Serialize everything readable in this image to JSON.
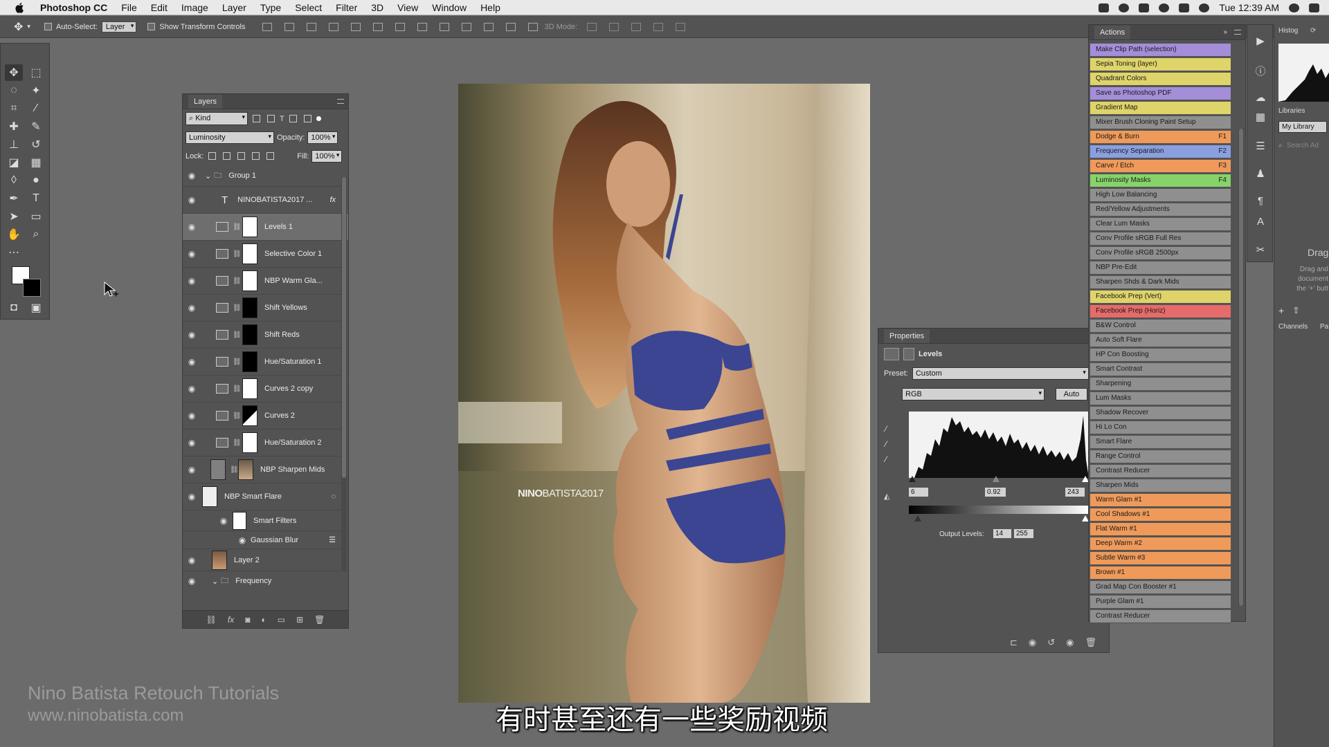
{
  "menubar": {
    "app_name": "Photoshop CC",
    "items": [
      "File",
      "Edit",
      "Image",
      "Layer",
      "Type",
      "Select",
      "Filter",
      "3D",
      "View",
      "Window",
      "Help"
    ],
    "clock": "Tue 12:39 AM"
  },
  "options_bar": {
    "auto_select_label": "Auto-Select:",
    "auto_select_value": "Layer",
    "show_transform_label": "Show Transform Controls",
    "mode_3d_label": "3D Mode:"
  },
  "layers_panel": {
    "tab": "Layers",
    "filter_kind": "Kind",
    "blend_mode": "Luminosity",
    "opacity_label": "Opacity:",
    "opacity_value": "100%",
    "lock_label": "Lock:",
    "fill_label": "Fill:",
    "fill_value": "100%",
    "group_name": "Group 1",
    "layers": [
      {
        "name": "NINOBATISTA2017 ...",
        "kind": "type",
        "fx": "fx"
      },
      {
        "name": "Levels 1",
        "kind": "adjustment",
        "mask": "white",
        "selected": true
      },
      {
        "name": "Selective Color 1",
        "kind": "adjustment",
        "mask": "white"
      },
      {
        "name": "NBP Warm Gla...",
        "kind": "adjustment",
        "mask": "white"
      },
      {
        "name": "Shift Yellows",
        "kind": "adjustment",
        "mask": "black"
      },
      {
        "name": "Shift Reds",
        "kind": "adjustment",
        "mask": "black"
      },
      {
        "name": "Hue/Saturation 1",
        "kind": "adjustment",
        "mask": "black"
      },
      {
        "name": "Curves 2 copy",
        "kind": "adjustment",
        "mask": "white"
      },
      {
        "name": "Curves 2",
        "kind": "adjustment",
        "mask": "mixed"
      },
      {
        "name": "Hue/Saturation 2",
        "kind": "adjustment",
        "mask": "white"
      },
      {
        "name": "NBP Sharpen Mids",
        "kind": "pixel"
      },
      {
        "name": "NBP Smart Flare",
        "kind": "smart"
      }
    ],
    "smart_filters_label": "Smart Filters",
    "gaussian_blur_label": "Gaussian Blur",
    "layer2": "Layer 2",
    "frequency_group": "Frequency"
  },
  "properties_panel": {
    "tab": "Properties",
    "title": "Levels",
    "preset_label": "Preset:",
    "preset_value": "Custom",
    "channel_value": "RGB",
    "auto_button": "Auto",
    "input_black": "6",
    "input_gamma": "0.92",
    "input_white": "243",
    "output_label": "Output Levels:",
    "output_black": "14",
    "output_white": "255"
  },
  "actions_panel": {
    "tab": "Actions",
    "items": [
      {
        "label": "Make Clip Path (selection)",
        "color": "purple",
        "key": ""
      },
      {
        "label": "Sepia Toning (layer)",
        "color": "yellow",
        "key": ""
      },
      {
        "label": "Quadrant Colors",
        "color": "yellow",
        "key": ""
      },
      {
        "label": "Save as Photoshop PDF",
        "color": "purple",
        "key": ""
      },
      {
        "label": "Gradient Map",
        "color": "yellow",
        "key": ""
      },
      {
        "label": "Mixer Brush Cloning Paint Setup",
        "color": "gray",
        "key": ""
      },
      {
        "label": "Dodge & Burn",
        "color": "orange",
        "key": "F1"
      },
      {
        "label": "Frequency Separation",
        "color": "blue",
        "key": "F2"
      },
      {
        "label": "Carve / Etch",
        "color": "orange",
        "key": "F3"
      },
      {
        "label": "Luminosity Masks",
        "color": "green",
        "key": "F4"
      },
      {
        "label": "High Low Balancing",
        "color": "gray",
        "key": ""
      },
      {
        "label": "Red/Yellow Adjustments",
        "color": "gray",
        "key": ""
      },
      {
        "label": "Clear Lum Masks",
        "color": "gray",
        "key": ""
      },
      {
        "label": "Conv Profile sRGB Full Res",
        "color": "gray",
        "key": ""
      },
      {
        "label": "Conv Profile sRGB 2500px",
        "color": "gray",
        "key": ""
      },
      {
        "label": "NBP Pre-Edit",
        "color": "gray",
        "key": ""
      },
      {
        "label": "Sharpen Shds & Dark Mids",
        "color": "gray",
        "key": ""
      },
      {
        "label": "Facebook Prep (Vert)",
        "color": "yellow",
        "key": ""
      },
      {
        "label": "Facebook Prep (Horiz)",
        "color": "red",
        "key": ""
      },
      {
        "label": "B&W Control",
        "color": "gray",
        "key": ""
      },
      {
        "label": "Auto Soft Flare",
        "color": "gray",
        "key": ""
      },
      {
        "label": "HP Con Boosting",
        "color": "gray",
        "key": ""
      },
      {
        "label": "Smart Contrast",
        "color": "gray",
        "key": ""
      },
      {
        "label": "Sharpening",
        "color": "gray",
        "key": ""
      },
      {
        "label": "Lum Masks",
        "color": "gray",
        "key": ""
      },
      {
        "label": "Shadow Recover",
        "color": "gray",
        "key": ""
      },
      {
        "label": "Hi Lo Con",
        "color": "gray",
        "key": ""
      },
      {
        "label": "Smart Flare",
        "color": "gray",
        "key": ""
      },
      {
        "label": "Range Control",
        "color": "gray",
        "key": ""
      },
      {
        "label": "Contrast Reducer",
        "color": "gray",
        "key": ""
      },
      {
        "label": "Sharpen Mids",
        "color": "gray",
        "key": ""
      },
      {
        "label": "Warm Glam #1",
        "color": "orange",
        "key": ""
      },
      {
        "label": "Cool Shadows #1",
        "color": "orange",
        "key": ""
      },
      {
        "label": "Flat Warm #1",
        "color": "orange",
        "key": ""
      },
      {
        "label": "Deep Warm #2",
        "color": "orange",
        "key": ""
      },
      {
        "label": "Subtle Warm #3",
        "color": "orange",
        "key": ""
      },
      {
        "label": "Brown #1",
        "color": "orange",
        "key": ""
      },
      {
        "label": "Grad Map Con Booster #1",
        "color": "gray",
        "key": ""
      },
      {
        "label": "Purple Glam #1",
        "color": "gray",
        "key": ""
      },
      {
        "label": "Contrast Reducer",
        "color": "gray",
        "key": ""
      }
    ]
  },
  "right_panel": {
    "histogram_tab": "Histog",
    "libraries_tab": "Libraries",
    "library_name": "My Library",
    "search_placeholder": "Search Ad",
    "drag_heading": "Drag",
    "drag_text": "Drag and document the '+' butt",
    "channels_tab": "Channels",
    "paths_tab": "Pa"
  },
  "canvas": {
    "watermark_bold": "NINO",
    "watermark_rest": "BATISTA2017"
  },
  "branding": {
    "line1": "Nino Batista Retouch Tutorials",
    "line2": "www.ninobatista.com"
  },
  "subtitle": "有时甚至还有一些奖励视频",
  "colors": {
    "purple": "#a48ed8",
    "yellow": "#ded46a",
    "gray": "#8f8f8f",
    "orange": "#ef9a5a",
    "blue": "#8a9fe0",
    "green": "#86d36a",
    "red": "#e66b6b"
  }
}
